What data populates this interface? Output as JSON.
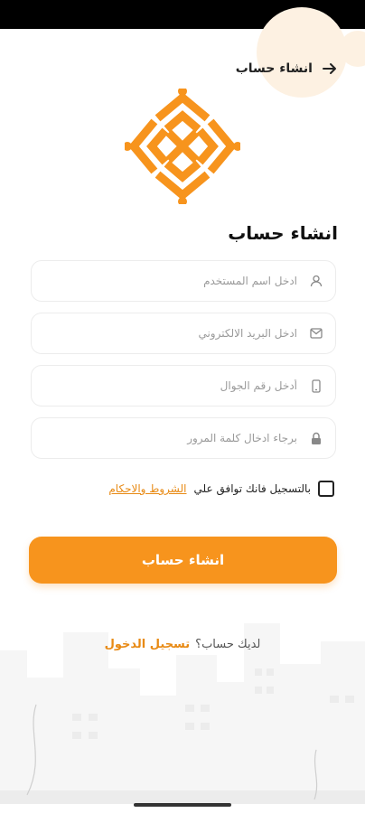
{
  "header": {
    "title": "انشاء حساب"
  },
  "form": {
    "heading": "انشاء حساب",
    "fields": [
      {
        "placeholder": "ادخل اسم المستخدم",
        "icon": "user-icon"
      },
      {
        "placeholder": "ادخل البريد الالكتروني",
        "icon": "mail-icon"
      },
      {
        "placeholder": "أدخل رقم الجوال",
        "icon": "phone-icon"
      },
      {
        "placeholder": "برجاء ادخال كلمة المرور",
        "icon": "lock-icon"
      }
    ],
    "terms_text": "بالتسجيل فانك توافق علي",
    "terms_link": "الشروط والاحكام",
    "submit_label": "انشاء حساب"
  },
  "footer": {
    "have_account": "لديك حساب؟",
    "login_link": "تسجيل الدخول"
  },
  "colors": {
    "accent": "#f7941d",
    "link": "#e88a14"
  }
}
